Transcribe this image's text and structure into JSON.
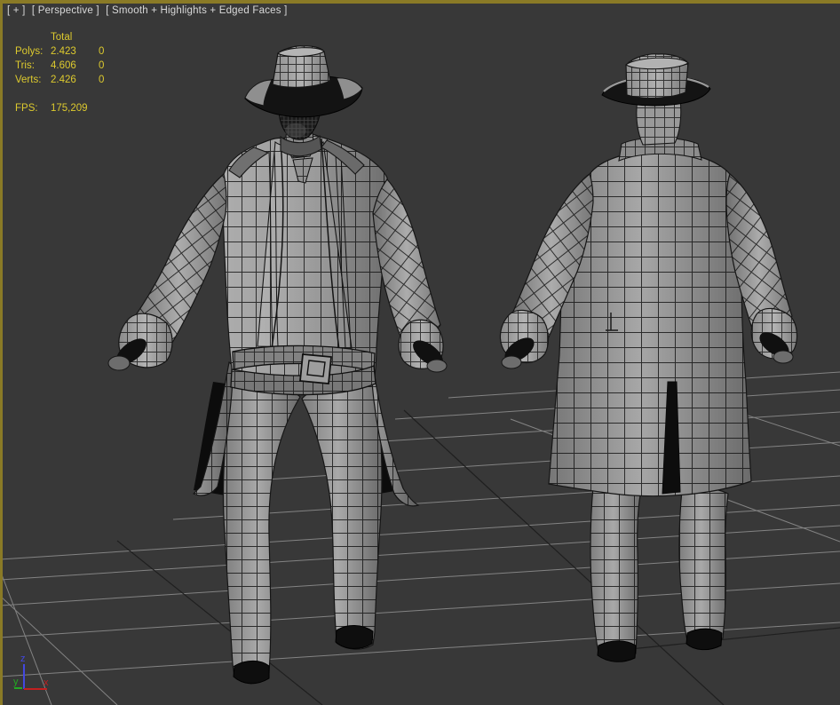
{
  "viewport": {
    "menus": [
      {
        "label": "[ + ]"
      },
      {
        "label": "[ Perspective ]"
      },
      {
        "label": "[ Smooth + Highlights + Edged Faces ]"
      }
    ],
    "statistics": {
      "header": "Total",
      "rows": [
        {
          "label": "Polys:",
          "total": "2.423",
          "selected": "0"
        },
        {
          "label": "Tris:",
          "total": "4.606",
          "selected": "0"
        },
        {
          "label": "Verts:",
          "total": "2.426",
          "selected": "0"
        }
      ],
      "fps": {
        "label": "FPS:",
        "value": "175,209"
      }
    },
    "axis_gizmo": {
      "x": "x",
      "y": "y",
      "z": "z"
    },
    "colors": {
      "background": "#383838",
      "active_border": "#8a7a26",
      "stats_text": "#ddca2e",
      "label_text": "#d9d9d9",
      "grid_line": "#969696",
      "grid_major_line": "#1f1f1f",
      "wireframe": "#161616",
      "axis_x": "#c22020",
      "axis_y": "#22a922",
      "axis_z": "#4348e0"
    }
  }
}
